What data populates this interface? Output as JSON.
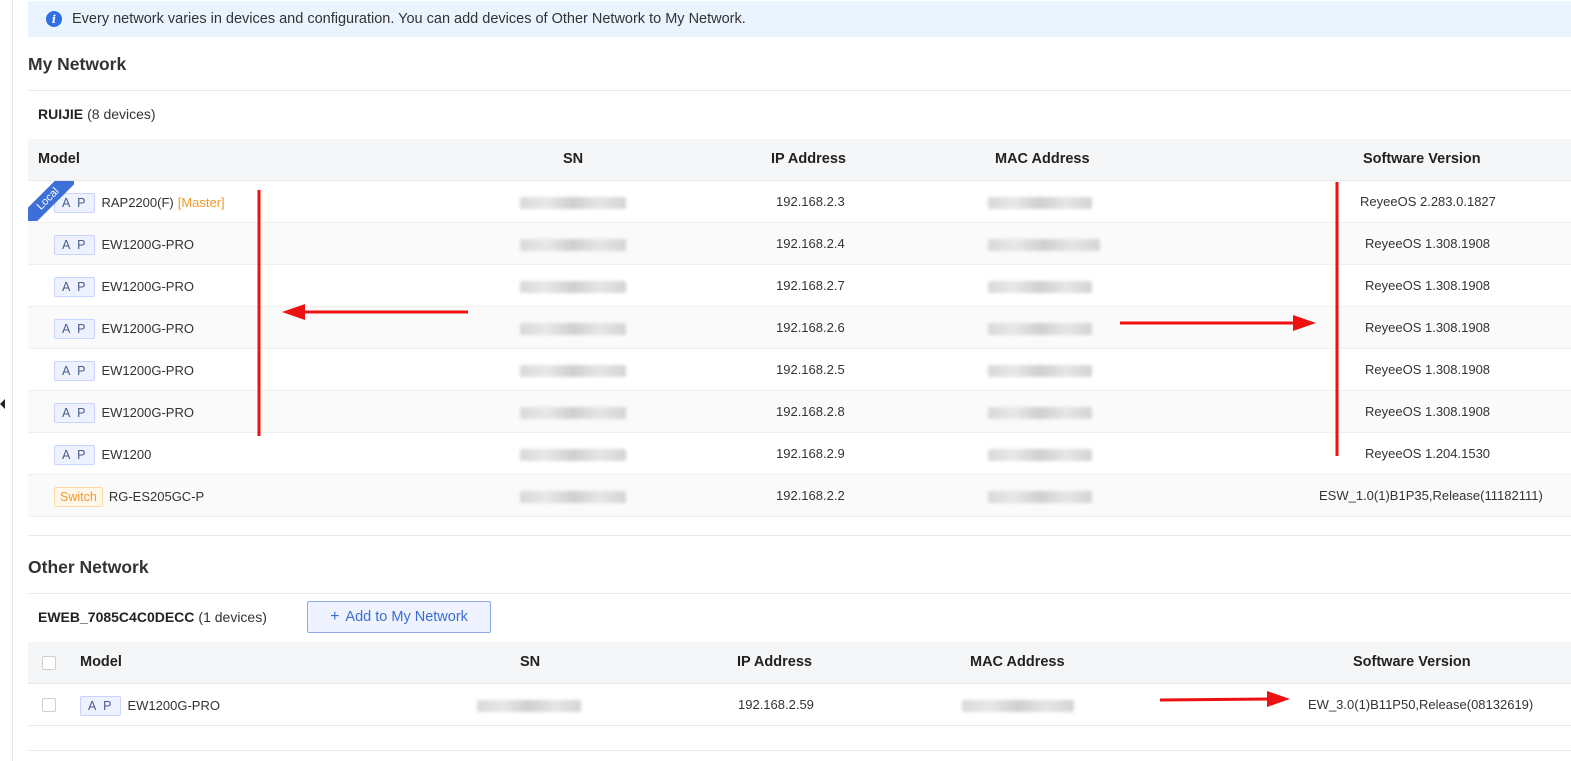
{
  "banner": {
    "text": "Every network varies in devices and configuration. You can add devices of Other Network to My Network.",
    "icon": "info-icon"
  },
  "my_network": {
    "title": "My Network",
    "group_name": "RUIJIE",
    "group_count": "(8 devices)",
    "local_label": "Local",
    "columns": [
      "Model",
      "SN",
      "IP Address",
      "MAC Address",
      "Software Version"
    ],
    "rows": [
      {
        "type": "A P",
        "model": "RAP2200(F)",
        "master": "[Master]",
        "ip": "192.168.2.3",
        "version": "ReyeeOS 2.283.0.1827"
      },
      {
        "type": "A P",
        "model": "EW1200G-PRO",
        "ip": "192.168.2.4",
        "version": "ReyeeOS 1.308.1908"
      },
      {
        "type": "A P",
        "model": "EW1200G-PRO",
        "ip": "192.168.2.7",
        "version": "ReyeeOS 1.308.1908"
      },
      {
        "type": "A P",
        "model": "EW1200G-PRO",
        "ip": "192.168.2.6",
        "version": "ReyeeOS 1.308.1908"
      },
      {
        "type": "A P",
        "model": "EW1200G-PRO",
        "ip": "192.168.2.5",
        "version": "ReyeeOS 1.308.1908"
      },
      {
        "type": "A P",
        "model": "EW1200G-PRO",
        "ip": "192.168.2.8",
        "version": "ReyeeOS 1.308.1908"
      },
      {
        "type": "A P",
        "model": "EW1200",
        "ip": "192.168.2.9",
        "version": "ReyeeOS 1.204.1530"
      },
      {
        "type": "Switch",
        "model": "RG-ES205GC-P",
        "ip": "192.168.2.2",
        "version": "ESW_1.0(1)B1P35,Release(11182111)"
      }
    ]
  },
  "other_network": {
    "title": "Other Network",
    "group_name": "EWEB_7085C4C0DECC",
    "group_count": "(1 devices)",
    "add_button": "Add to My Network",
    "columns": [
      "Model",
      "SN",
      "IP Address",
      "MAC Address",
      "Software Version"
    ],
    "rows": [
      {
        "type": "A P",
        "model": "EW1200G-PRO",
        "ip": "192.168.2.59",
        "version": "EW_3.0(1)B11P50,Release(08132619)"
      }
    ]
  },
  "colors": {
    "accent": "#3b6ed6",
    "annotation": "#ee1111",
    "switch_tag": "#f29a2e",
    "banner_bg": "#eaf4ff"
  }
}
